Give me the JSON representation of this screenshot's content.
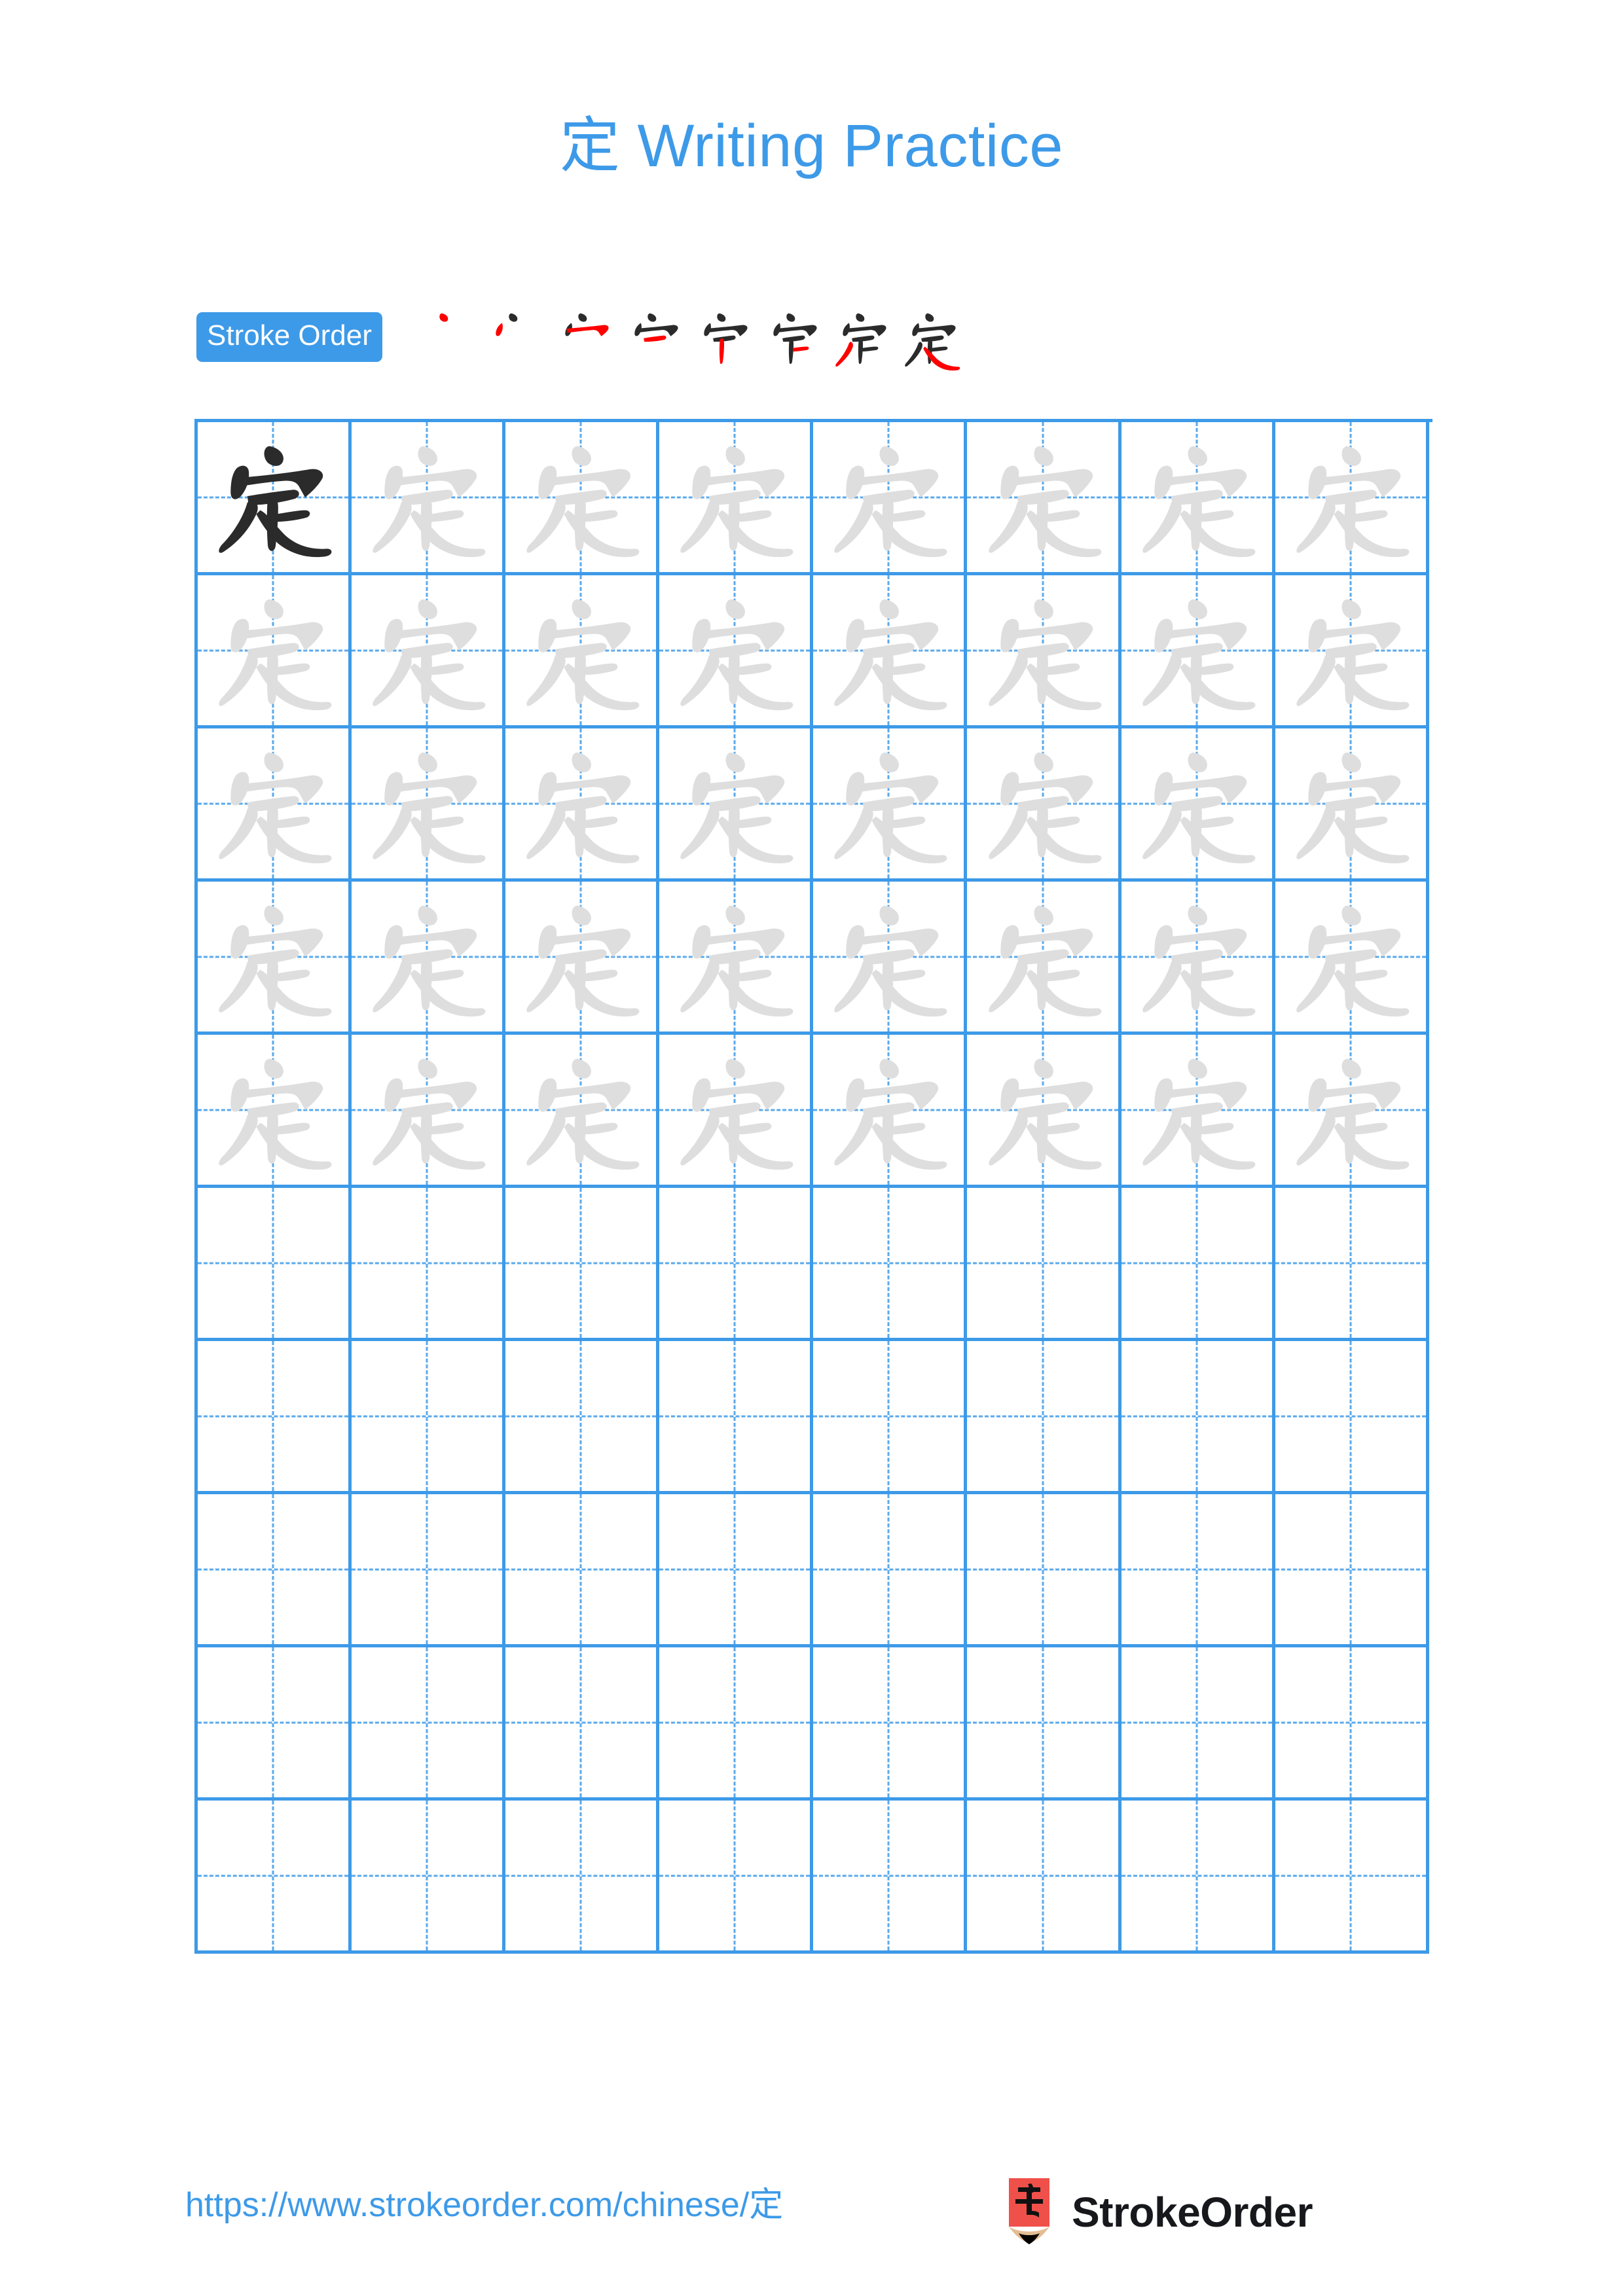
{
  "document": {
    "character": "定",
    "title": "定 Writing Practice",
    "accent_color": "#3d9ae8",
    "model_stroke_color": "#2b2b2b",
    "trace_stroke_color": "#dedede",
    "highlight_stroke_color": "#ff0000",
    "page_background": "#ffffff"
  },
  "stroke_order": {
    "badge_label": "Stroke Order",
    "total_strokes": 8,
    "steps": [
      {
        "index": 1,
        "name": "dian-dot",
        "strokes_shown": 1
      },
      {
        "index": 2,
        "name": "dian-left-dot",
        "strokes_shown": 2
      },
      {
        "index": 3,
        "name": "hengou-horizontal-hook",
        "strokes_shown": 3
      },
      {
        "index": 4,
        "name": "heng-horizontal",
        "strokes_shown": 4
      },
      {
        "index": 5,
        "name": "shu-vertical",
        "strokes_shown": 5
      },
      {
        "index": 6,
        "name": "heng-horizontal-2",
        "strokes_shown": 6
      },
      {
        "index": 7,
        "name": "pie-left-falling",
        "strokes_shown": 7
      },
      {
        "index": 8,
        "name": "na-right-falling",
        "strokes_shown": 8
      }
    ]
  },
  "practice_grid": {
    "columns": 8,
    "rows": 10,
    "filled_rows": 5,
    "empty_rows": 5,
    "model_cell": {
      "row": 1,
      "column": 1
    },
    "grid_line_color": "#3d9ae8",
    "guide_line_color": "#5aa9ec",
    "rows_data": [
      {
        "row": 1,
        "cells": [
          "model",
          "trace",
          "trace",
          "trace",
          "trace",
          "trace",
          "trace",
          "trace"
        ]
      },
      {
        "row": 2,
        "cells": [
          "trace",
          "trace",
          "trace",
          "trace",
          "trace",
          "trace",
          "trace",
          "trace"
        ]
      },
      {
        "row": 3,
        "cells": [
          "trace",
          "trace",
          "trace",
          "trace",
          "trace",
          "trace",
          "trace",
          "trace"
        ]
      },
      {
        "row": 4,
        "cells": [
          "trace",
          "trace",
          "trace",
          "trace",
          "trace",
          "trace",
          "trace",
          "trace"
        ]
      },
      {
        "row": 5,
        "cells": [
          "trace",
          "trace",
          "trace",
          "trace",
          "trace",
          "trace",
          "trace",
          "trace"
        ]
      },
      {
        "row": 6,
        "cells": [
          "empty",
          "empty",
          "empty",
          "empty",
          "empty",
          "empty",
          "empty",
          "empty"
        ]
      },
      {
        "row": 7,
        "cells": [
          "empty",
          "empty",
          "empty",
          "empty",
          "empty",
          "empty",
          "empty",
          "empty"
        ]
      },
      {
        "row": 8,
        "cells": [
          "empty",
          "empty",
          "empty",
          "empty",
          "empty",
          "empty",
          "empty",
          "empty"
        ]
      },
      {
        "row": 9,
        "cells": [
          "empty",
          "empty",
          "empty",
          "empty",
          "empty",
          "empty",
          "empty",
          "empty"
        ]
      },
      {
        "row": 10,
        "cells": [
          "empty",
          "empty",
          "empty",
          "empty",
          "empty",
          "empty",
          "empty",
          "empty"
        ]
      }
    ]
  },
  "footer": {
    "url": "https://www.strokeorder.com/chinese/定",
    "brand_name": "StrokeOrder",
    "logo": {
      "name": "pencil-logo",
      "glyph": "字",
      "body_color": "#f0504a",
      "wood_color": "#e3bd93",
      "tip_color": "#000000"
    }
  }
}
